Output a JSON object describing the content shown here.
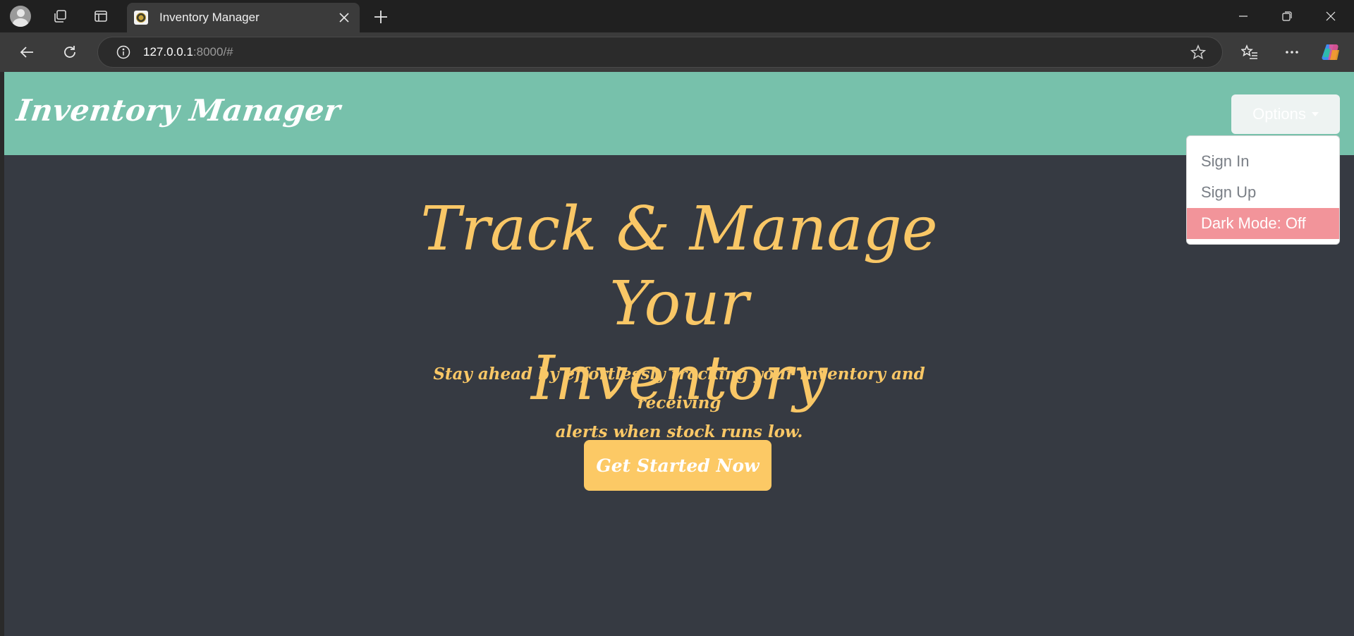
{
  "browser": {
    "tab_title": "Inventory Manager",
    "url_host": "127.0.0.1",
    "url_rest": ":8000/#"
  },
  "navbar": {
    "brand": "Inventory Manager",
    "options_label": "Options",
    "dropdown": [
      {
        "label": "Sign In"
      },
      {
        "label": "Sign Up"
      },
      {
        "label": "Dark Mode: Off"
      }
    ]
  },
  "hero": {
    "title_line1": "Track & Manage Your",
    "title_line2": "Inventory",
    "subtitle_line1": "Stay ahead by effortlessly tracking your inventory and receiving",
    "subtitle_line2": "alerts when stock runs low.",
    "cta_label": "Get Started Now"
  },
  "colors": {
    "navbar_bg": "#77c1ab",
    "page_bg": "#363a42",
    "accent_yellow": "#f9c766",
    "dropdown_active": "#f2949a"
  }
}
